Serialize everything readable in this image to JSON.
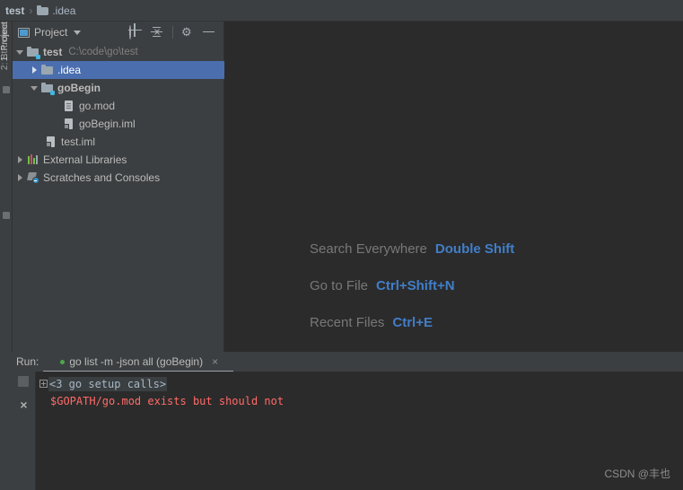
{
  "breadcrumb": {
    "items": [
      {
        "label": "test",
        "icon": "",
        "bold": true
      },
      {
        "label": ".idea",
        "icon": "folder-icon",
        "bold": false
      }
    ],
    "separator": "›"
  },
  "toolstrip": {
    "tabs": [
      {
        "label": "1: Project",
        "active": true
      },
      {
        "label": "2: Structure",
        "active": false
      }
    ]
  },
  "project_panel": {
    "title": "Project",
    "caret": "▾",
    "actions": [
      {
        "name": "locate-icon",
        "tooltip": "Select Opened File"
      },
      {
        "name": "collapse-all-icon",
        "tooltip": "Collapse All"
      },
      {
        "name": "gear-icon",
        "tooltip": "Settings",
        "glyph": "⚙"
      },
      {
        "name": "hide-icon",
        "tooltip": "Hide"
      }
    ],
    "tree": [
      {
        "label": "test",
        "path": "C:\\code\\go\\test",
        "icon": "module-folder-icon",
        "arrow": "down",
        "indent": 0,
        "bold": true,
        "selected": false
      },
      {
        "label": ".idea",
        "path": "",
        "icon": "folder-icon",
        "arrow": "right",
        "indent": 1,
        "bold": false,
        "selected": true
      },
      {
        "label": "goBegin",
        "path": "",
        "icon": "module-folder-icon",
        "arrow": "down",
        "indent": 1,
        "bold": true,
        "selected": false
      },
      {
        "label": "go.mod",
        "path": "",
        "icon": "file-icon",
        "arrow": "none",
        "indent": 2,
        "bold": false,
        "selected": false
      },
      {
        "label": "goBegin.iml",
        "path": "",
        "icon": "iml-file-icon",
        "arrow": "none",
        "indent": 2,
        "bold": false,
        "selected": false
      },
      {
        "label": "test.iml",
        "path": "",
        "icon": "iml-file-icon",
        "arrow": "none",
        "indent": 1,
        "bold": false,
        "selected": false
      },
      {
        "label": "External Libraries",
        "path": "",
        "icon": "libraries-icon",
        "arrow": "right",
        "indent": 0,
        "bold": false,
        "selected": false
      },
      {
        "label": "Scratches and Consoles",
        "path": "",
        "icon": "scratches-icon",
        "arrow": "right",
        "indent": 0,
        "bold": false,
        "selected": false
      }
    ]
  },
  "editor": {
    "shortcuts": [
      {
        "name": "Search Everywhere",
        "key": "Double Shift"
      },
      {
        "name": "Go to File",
        "key": "Ctrl+Shift+N"
      },
      {
        "name": "Recent Files",
        "key": "Ctrl+E"
      }
    ]
  },
  "run_window": {
    "label": "Run:",
    "tab": {
      "title": "go list -m -json all (goBegin)",
      "status": "running",
      "close": "×"
    },
    "gutter": [
      {
        "name": "stop-button",
        "enabled": false
      },
      {
        "name": "close-button",
        "glyph": "×"
      }
    ],
    "console": {
      "folded_line": "<3 go setup calls>",
      "error_line": "$GOPATH/go.mod exists but should not"
    }
  },
  "watermark": "CSDN @丰也",
  "colors": {
    "panel_bg": "#3c3f41",
    "editor_bg": "#2b2b2b",
    "selection": "#4b6eaf",
    "accent_link": "#417ec9",
    "error": "#ff6b68",
    "status_running": "#4ca64c"
  }
}
